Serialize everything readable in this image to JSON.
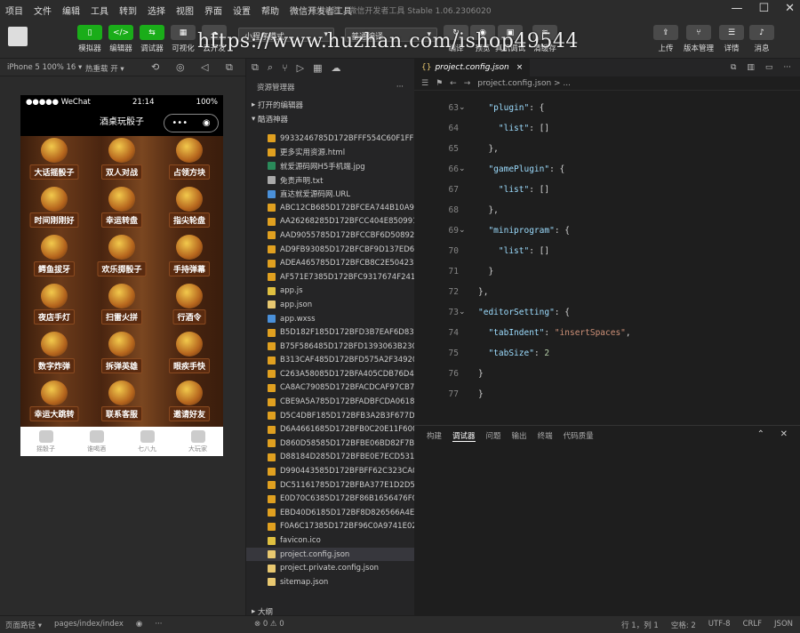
{
  "menu": [
    "项目",
    "文件",
    "编辑",
    "工具",
    "转到",
    "选择",
    "视图",
    "界面",
    "设置",
    "帮助",
    "微信开发者工具"
  ],
  "window_title": "哦妇神器 - 微信开发者工具 Stable 1.06.2306020",
  "toolbar": {
    "btn_simulator": "模拟器",
    "btn_editor": "编辑器",
    "btn_debugger": "调试器",
    "btn_visual": "可视化",
    "btn_cloud": "云开发",
    "mode_select": "小程序模式",
    "compile_select": "普通编译",
    "btn_compile": "编译",
    "btn_preview": "预览",
    "btn_realdebug": "真机调试",
    "btn_clearcache": "清缓存",
    "btn_upload": "上传",
    "btn_version": "版本管理",
    "btn_detail": "详情",
    "btn_message": "消息"
  },
  "watermark": "https://www.huzhan.com/ishop49544",
  "simulator": {
    "device": "iPhone 5 100% 16 ▾",
    "hotreload": "热重载 开 ▾"
  },
  "phone": {
    "carrier": "●●●●● WeChat",
    "time": "21:14",
    "battery": "100%",
    "nav_title": "酒桌玩骰子",
    "capsule_dots": "•••",
    "items": [
      "大话摇骰子",
      "双人对战",
      "占领方块",
      "时间刚刚好",
      "幸运转盘",
      "指尖轮盘",
      "鳄鱼拔牙",
      "欢乐掷骰子",
      "手持弹幕",
      "夜店手灯",
      "扫雷火拼",
      "行酒令",
      "数字炸弹",
      "拆弹英雄",
      "眼疾手快",
      "幸运大跳转",
      "联系客服",
      "邀请好友"
    ],
    "tabs": [
      "摇骰子",
      "谁喝酒",
      "七八九",
      "大玩家"
    ]
  },
  "explorer": {
    "title": "资源管理器",
    "open_editors": "打开的编辑器",
    "project": "酷酒神器",
    "files": [
      {
        "name": "9933246785D172BFFF554C60F1FF6...",
        "type": "img"
      },
      {
        "name": "更多实用资源.html",
        "type": "html"
      },
      {
        "name": "就爱源码网H5手机端.jpg",
        "type": "jpg"
      },
      {
        "name": "免责声明.txt",
        "type": "txt"
      },
      {
        "name": "直达就爱源码网.URL",
        "type": "url"
      },
      {
        "name": "ABC12CB685D172BFCEA744B10A9...",
        "type": "img"
      },
      {
        "name": "AA26268285D172BFCC404E850991...",
        "type": "img"
      },
      {
        "name": "AAD9055785D172BFCCBF6D50892...",
        "type": "img"
      },
      {
        "name": "AD9FB93085D172BFCBF9D137ED6...",
        "type": "img"
      },
      {
        "name": "ADEA465785D172BFCB8C2E50423...",
        "type": "img"
      },
      {
        "name": "AF571E7385D172BFC9317674F241...",
        "type": "img"
      },
      {
        "name": "app.js",
        "type": "js"
      },
      {
        "name": "app.json",
        "type": "json"
      },
      {
        "name": "app.wxss",
        "type": "wxss"
      },
      {
        "name": "B5D182F185D172BFD3B7EAF6D831...",
        "type": "img"
      },
      {
        "name": "B75F586485D172BFD1393063B230...",
        "type": "img"
      },
      {
        "name": "B313CAF485D172BFD575A2F34920...",
        "type": "img"
      },
      {
        "name": "C263A58085D172BFA405CDB76D4...",
        "type": "img"
      },
      {
        "name": "CA8AC79085D172BFACDCAF97CB7...",
        "type": "img"
      },
      {
        "name": "CBE9A5A785D172BFADBFCDA0618...",
        "type": "img"
      },
      {
        "name": "D5C4DBF185D172BFB3A2B3F677D...",
        "type": "img"
      },
      {
        "name": "D6A4661685D172BFB0C20E11F600...",
        "type": "img"
      },
      {
        "name": "D860D58585D172BFBE06BD82F7B1...",
        "type": "img"
      },
      {
        "name": "D88184D285D172BFBE0E7ECD531F...",
        "type": "img"
      },
      {
        "name": "D990443585D172BFBFF62C323CA0...",
        "type": "img"
      },
      {
        "name": "DC51161785D172BFBA377E1D2D5...",
        "type": "img"
      },
      {
        "name": "E0D70C6385D172BF86B1656476F0...",
        "type": "img"
      },
      {
        "name": "EBD40D6185D172BF8D826566A4E...",
        "type": "img"
      },
      {
        "name": "F0A6C17385D172BF96C0A9741E02...",
        "type": "img"
      },
      {
        "name": "favicon.ico",
        "type": "ico"
      },
      {
        "name": "project.config.json",
        "type": "json"
      },
      {
        "name": "project.private.config.json",
        "type": "json"
      },
      {
        "name": "sitemap.json",
        "type": "json"
      }
    ],
    "outline": "大纲"
  },
  "editor": {
    "tab": "project.config.json",
    "breadcrumb": "project.config.json > ...",
    "lines": [
      {
        "n": "63",
        "t": "  \"plugin\": {"
      },
      {
        "n": "64",
        "t": "    \"list\": []"
      },
      {
        "n": "65",
        "t": "  },"
      },
      {
        "n": "66",
        "t": "  \"gamePlugin\": {"
      },
      {
        "n": "67",
        "t": "    \"list\": []"
      },
      {
        "n": "68",
        "t": "  },"
      },
      {
        "n": "69",
        "t": "  \"miniprogram\": {"
      },
      {
        "n": "70",
        "t": "    \"list\": []"
      },
      {
        "n": "71",
        "t": "  }"
      },
      {
        "n": "72",
        "t": "},"
      },
      {
        "n": "73",
        "t": "\"editorSetting\": {"
      },
      {
        "n": "74",
        "t": "  \"tabIndent\": \"insertSpaces\","
      },
      {
        "n": "75",
        "t": "  \"tabSize\": 2"
      },
      {
        "n": "76",
        "t": "}"
      },
      {
        "n": "77",
        "t": "}"
      }
    ]
  },
  "panel_tabs": [
    "构建",
    "调试器",
    "问题",
    "输出",
    "终端",
    "代码质量"
  ],
  "statusbar": {
    "page_path_label": "页面路径 ▾",
    "page_path": "pages/index/index",
    "errors": "⊗ 0 ⚠ 0",
    "position": "行 1，列 1",
    "spaces": "空格: 2",
    "encoding": "UTF-8",
    "eol": "CRLF",
    "lang": "JSON"
  }
}
